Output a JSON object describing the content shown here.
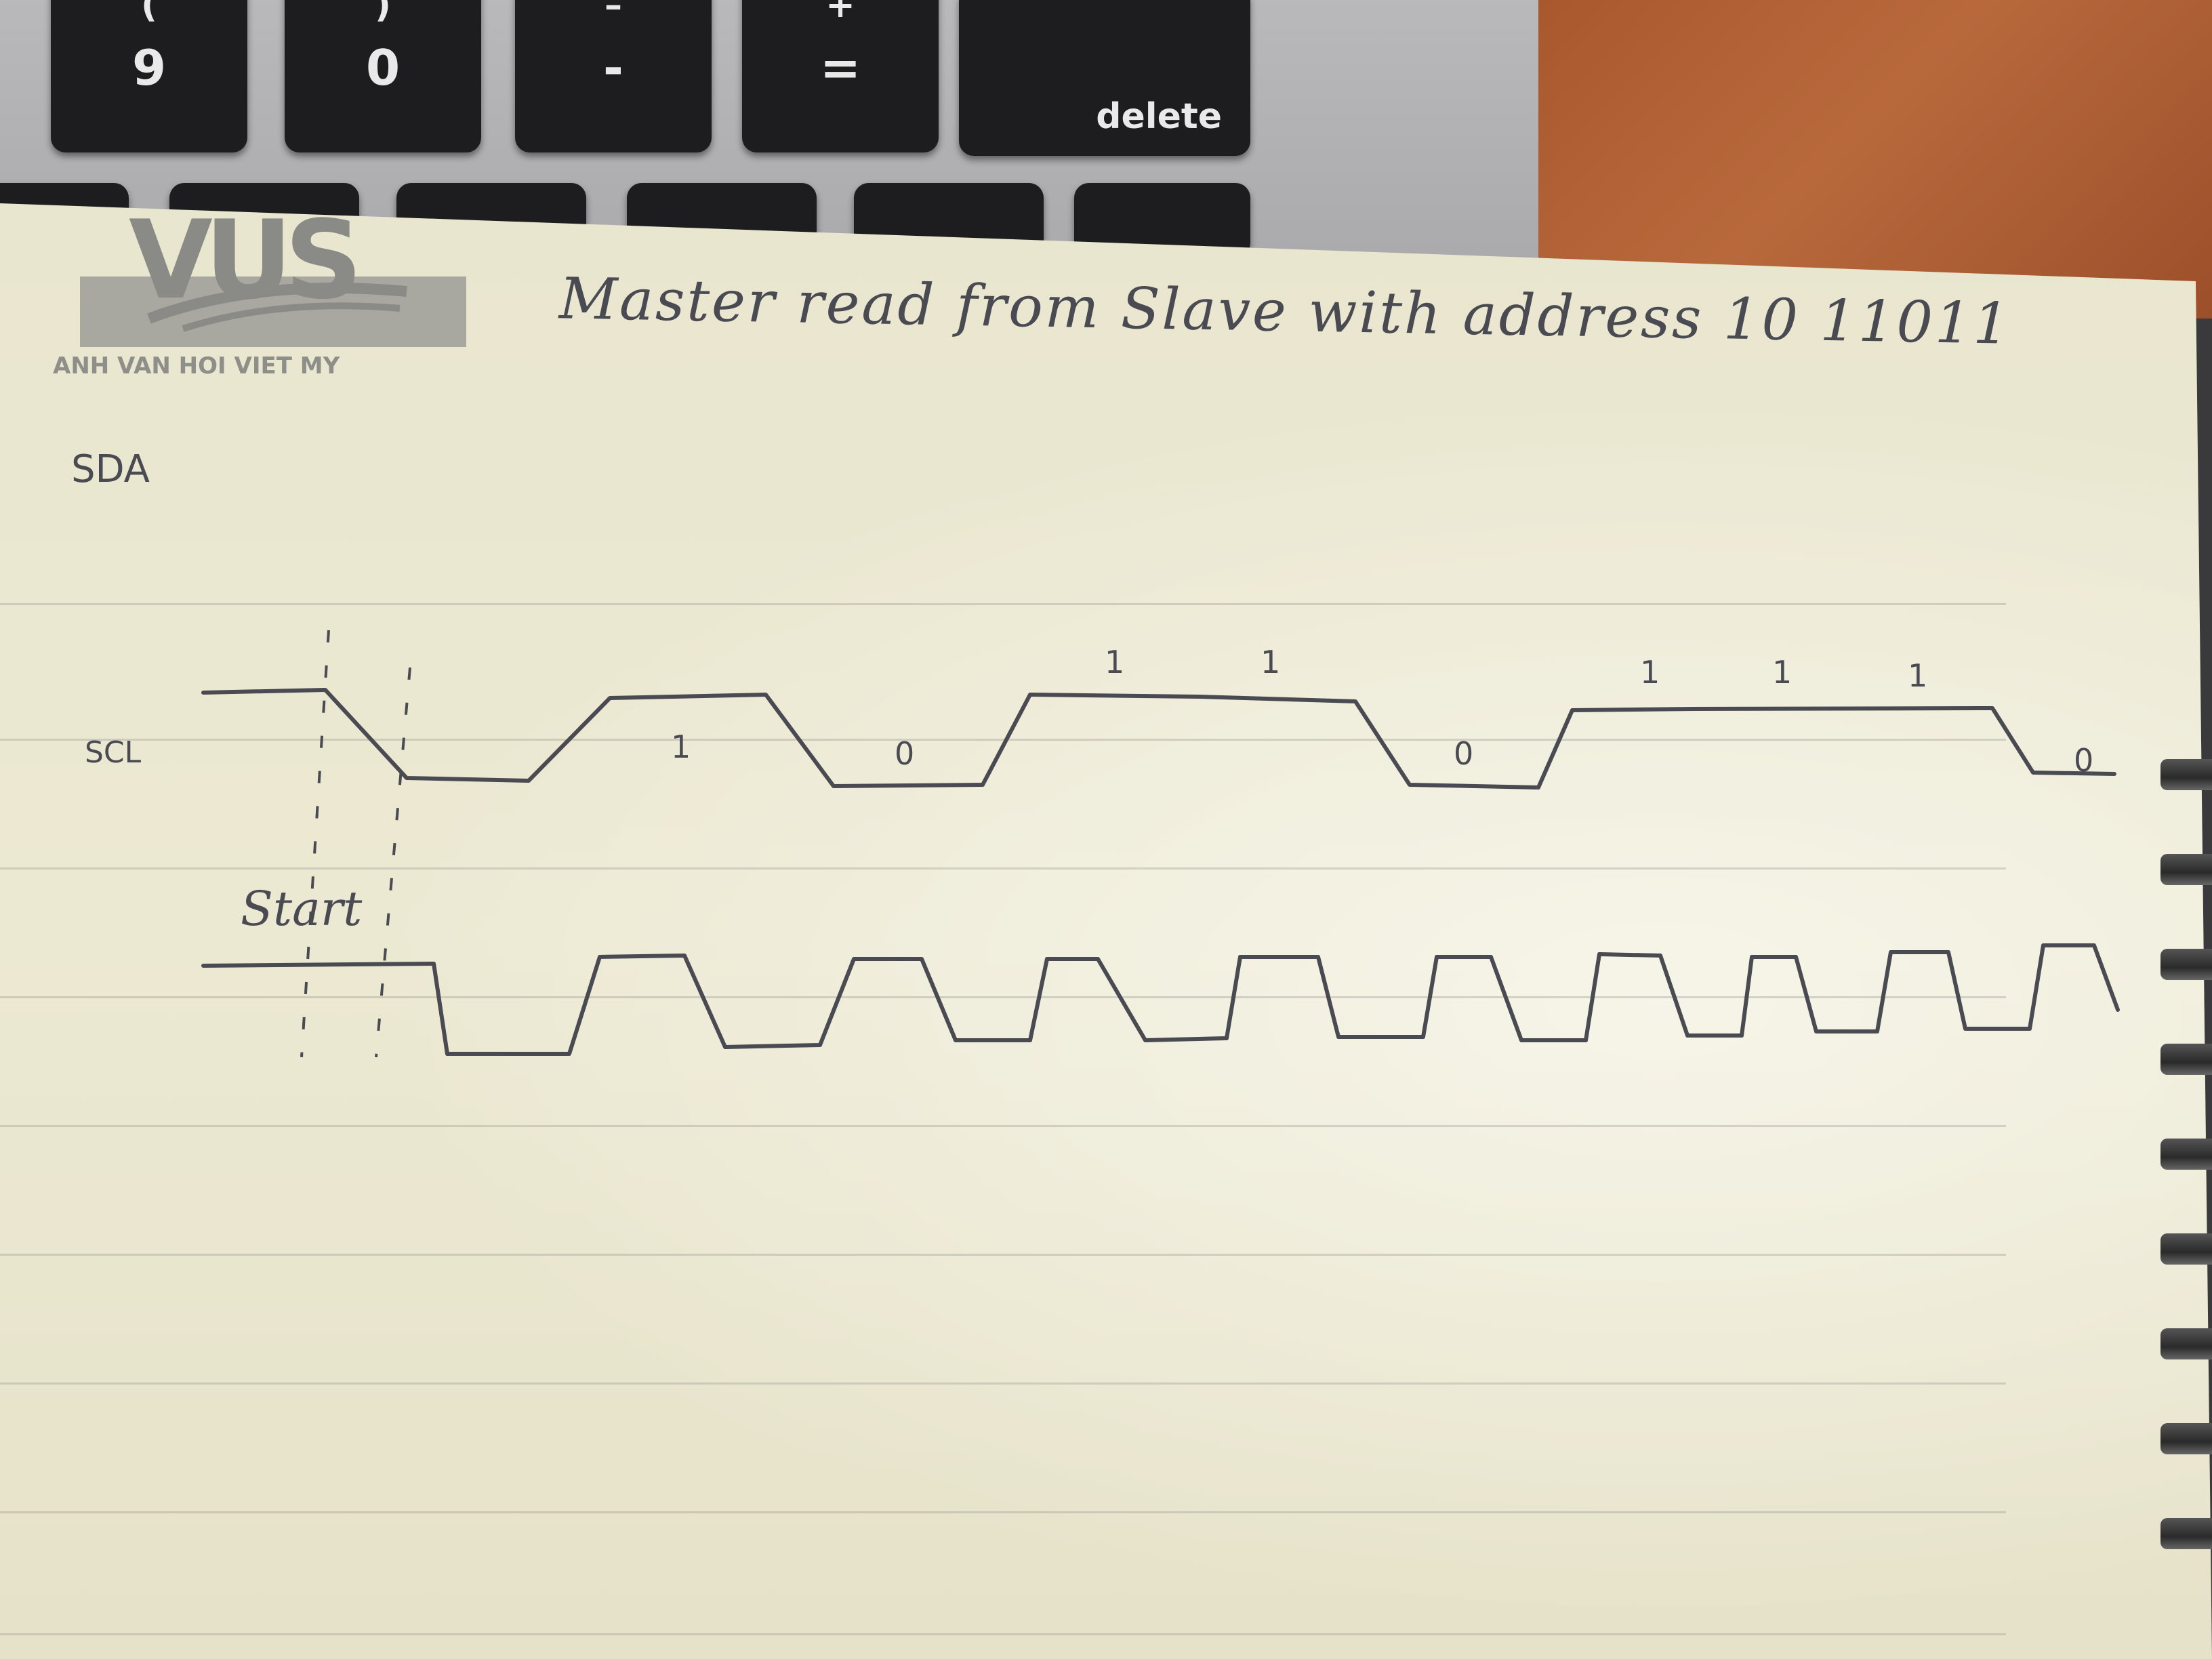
{
  "keyboard": {
    "keys": [
      {
        "upper": "(",
        "lower": "9"
      },
      {
        "upper": ")",
        "lower": "0"
      },
      {
        "upper": "–",
        "lower": "-"
      },
      {
        "upper": "+",
        "lower": "="
      },
      {
        "single": "delete"
      }
    ]
  },
  "notebook": {
    "logo": {
      "wordmark": "VUS",
      "tagline": "ANH VAN HOI VIET MY"
    },
    "title_note": "Master read from Slave with address 10 11011",
    "signals": {
      "sda_label": "SDA",
      "scl_label": "SCL",
      "start_label": "Start"
    },
    "bit_labels_low": [
      "1",
      "0",
      "0",
      "0"
    ],
    "bit_labels_high": [
      "1",
      "1",
      "1",
      "1",
      "1"
    ]
  },
  "colors": {
    "ink": "#4a4a52",
    "paper": "#ebe8d2",
    "keyboard_body": "#b0b0b2",
    "key": "#1d1d1f",
    "surface_orange": "#ad5e33"
  }
}
